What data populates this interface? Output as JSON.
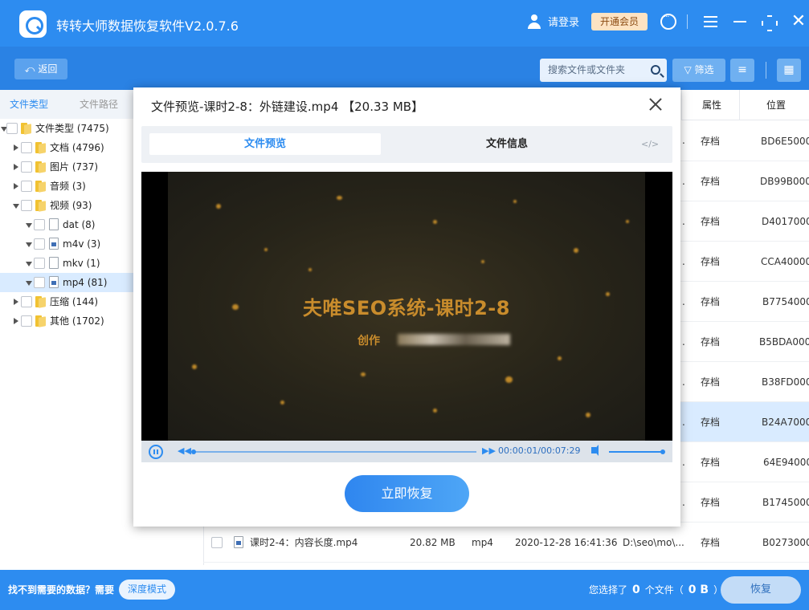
{
  "app": {
    "title": "转转大师数据恢复软件V2.0.7.6",
    "login_label": "请登录",
    "vip_label": "开通会员"
  },
  "toolbar": {
    "back_label": "返回",
    "search_placeholder": "搜索文件或文件夹",
    "filter_label": "筛选"
  },
  "left_tabs": [
    "文件类型",
    "文件路径"
  ],
  "tree": {
    "root": "文件类型 (7475)",
    "items": [
      {
        "label": "文档 (4796)"
      },
      {
        "label": "图片 (737)"
      },
      {
        "label": "音频 (3)"
      },
      {
        "label": "视频 (93)"
      },
      {
        "label": "dat (8)"
      },
      {
        "label": "m4v (3)"
      },
      {
        "label": "mkv (1)"
      },
      {
        "label": "mp4 (81)"
      },
      {
        "label": "压缩 (144)"
      },
      {
        "label": "其他 (1702)"
      }
    ]
  },
  "table": {
    "headers": {
      "attr": "属性",
      "location": "位置"
    },
    "rows": [
      {
        "attr": "存档",
        "loc": "BD6E5000"
      },
      {
        "attr": "存档",
        "loc": "DB99B000"
      },
      {
        "attr": "存档",
        "loc": "D4017000"
      },
      {
        "attr": "存档",
        "loc": "CCA40000"
      },
      {
        "attr": "存档",
        "loc": "B7754000"
      },
      {
        "attr": "存档",
        "loc": "B5BDA000"
      },
      {
        "attr": "存档",
        "loc": "B38FD000"
      },
      {
        "attr": "存档",
        "loc": "B24A7000"
      },
      {
        "attr": "存档",
        "loc": "64E94000"
      },
      {
        "attr": "存档",
        "loc": "B1745000"
      }
    ],
    "last_row": {
      "name": "课时2-4：内容长度.mp4",
      "size": "20.82 MB",
      "type": "mp4",
      "date": "2020-12-28 16:41:36",
      "path": "D:\\seo\\mo\\...",
      "attr": "存档",
      "loc": "B0273000"
    }
  },
  "bottom": {
    "hint": "找不到需要的数据？需要",
    "deep_label": "深度模式",
    "sel_prefix": "您选择了",
    "sel_count": "0",
    "sel_mid": "个文件（",
    "sel_size": "0 B",
    "sel_suffix": "）",
    "recover_label": "恢复"
  },
  "modal": {
    "title": "文件预览-课时2-8：外链建设.mp4 【20.33 MB】",
    "tab_preview": "文件预览",
    "tab_info": "文件信息",
    "code_icon": "</>",
    "video_title": "夫唯SEO系统-课时2-8",
    "video_sub": "创作",
    "time": "00:00:01/00:07:29",
    "recover_now": "立即恢复"
  },
  "colors": {
    "primary": "#2d8cf0",
    "vip_bg": "#fde3c3",
    "selected_row": "#d9ebff"
  }
}
